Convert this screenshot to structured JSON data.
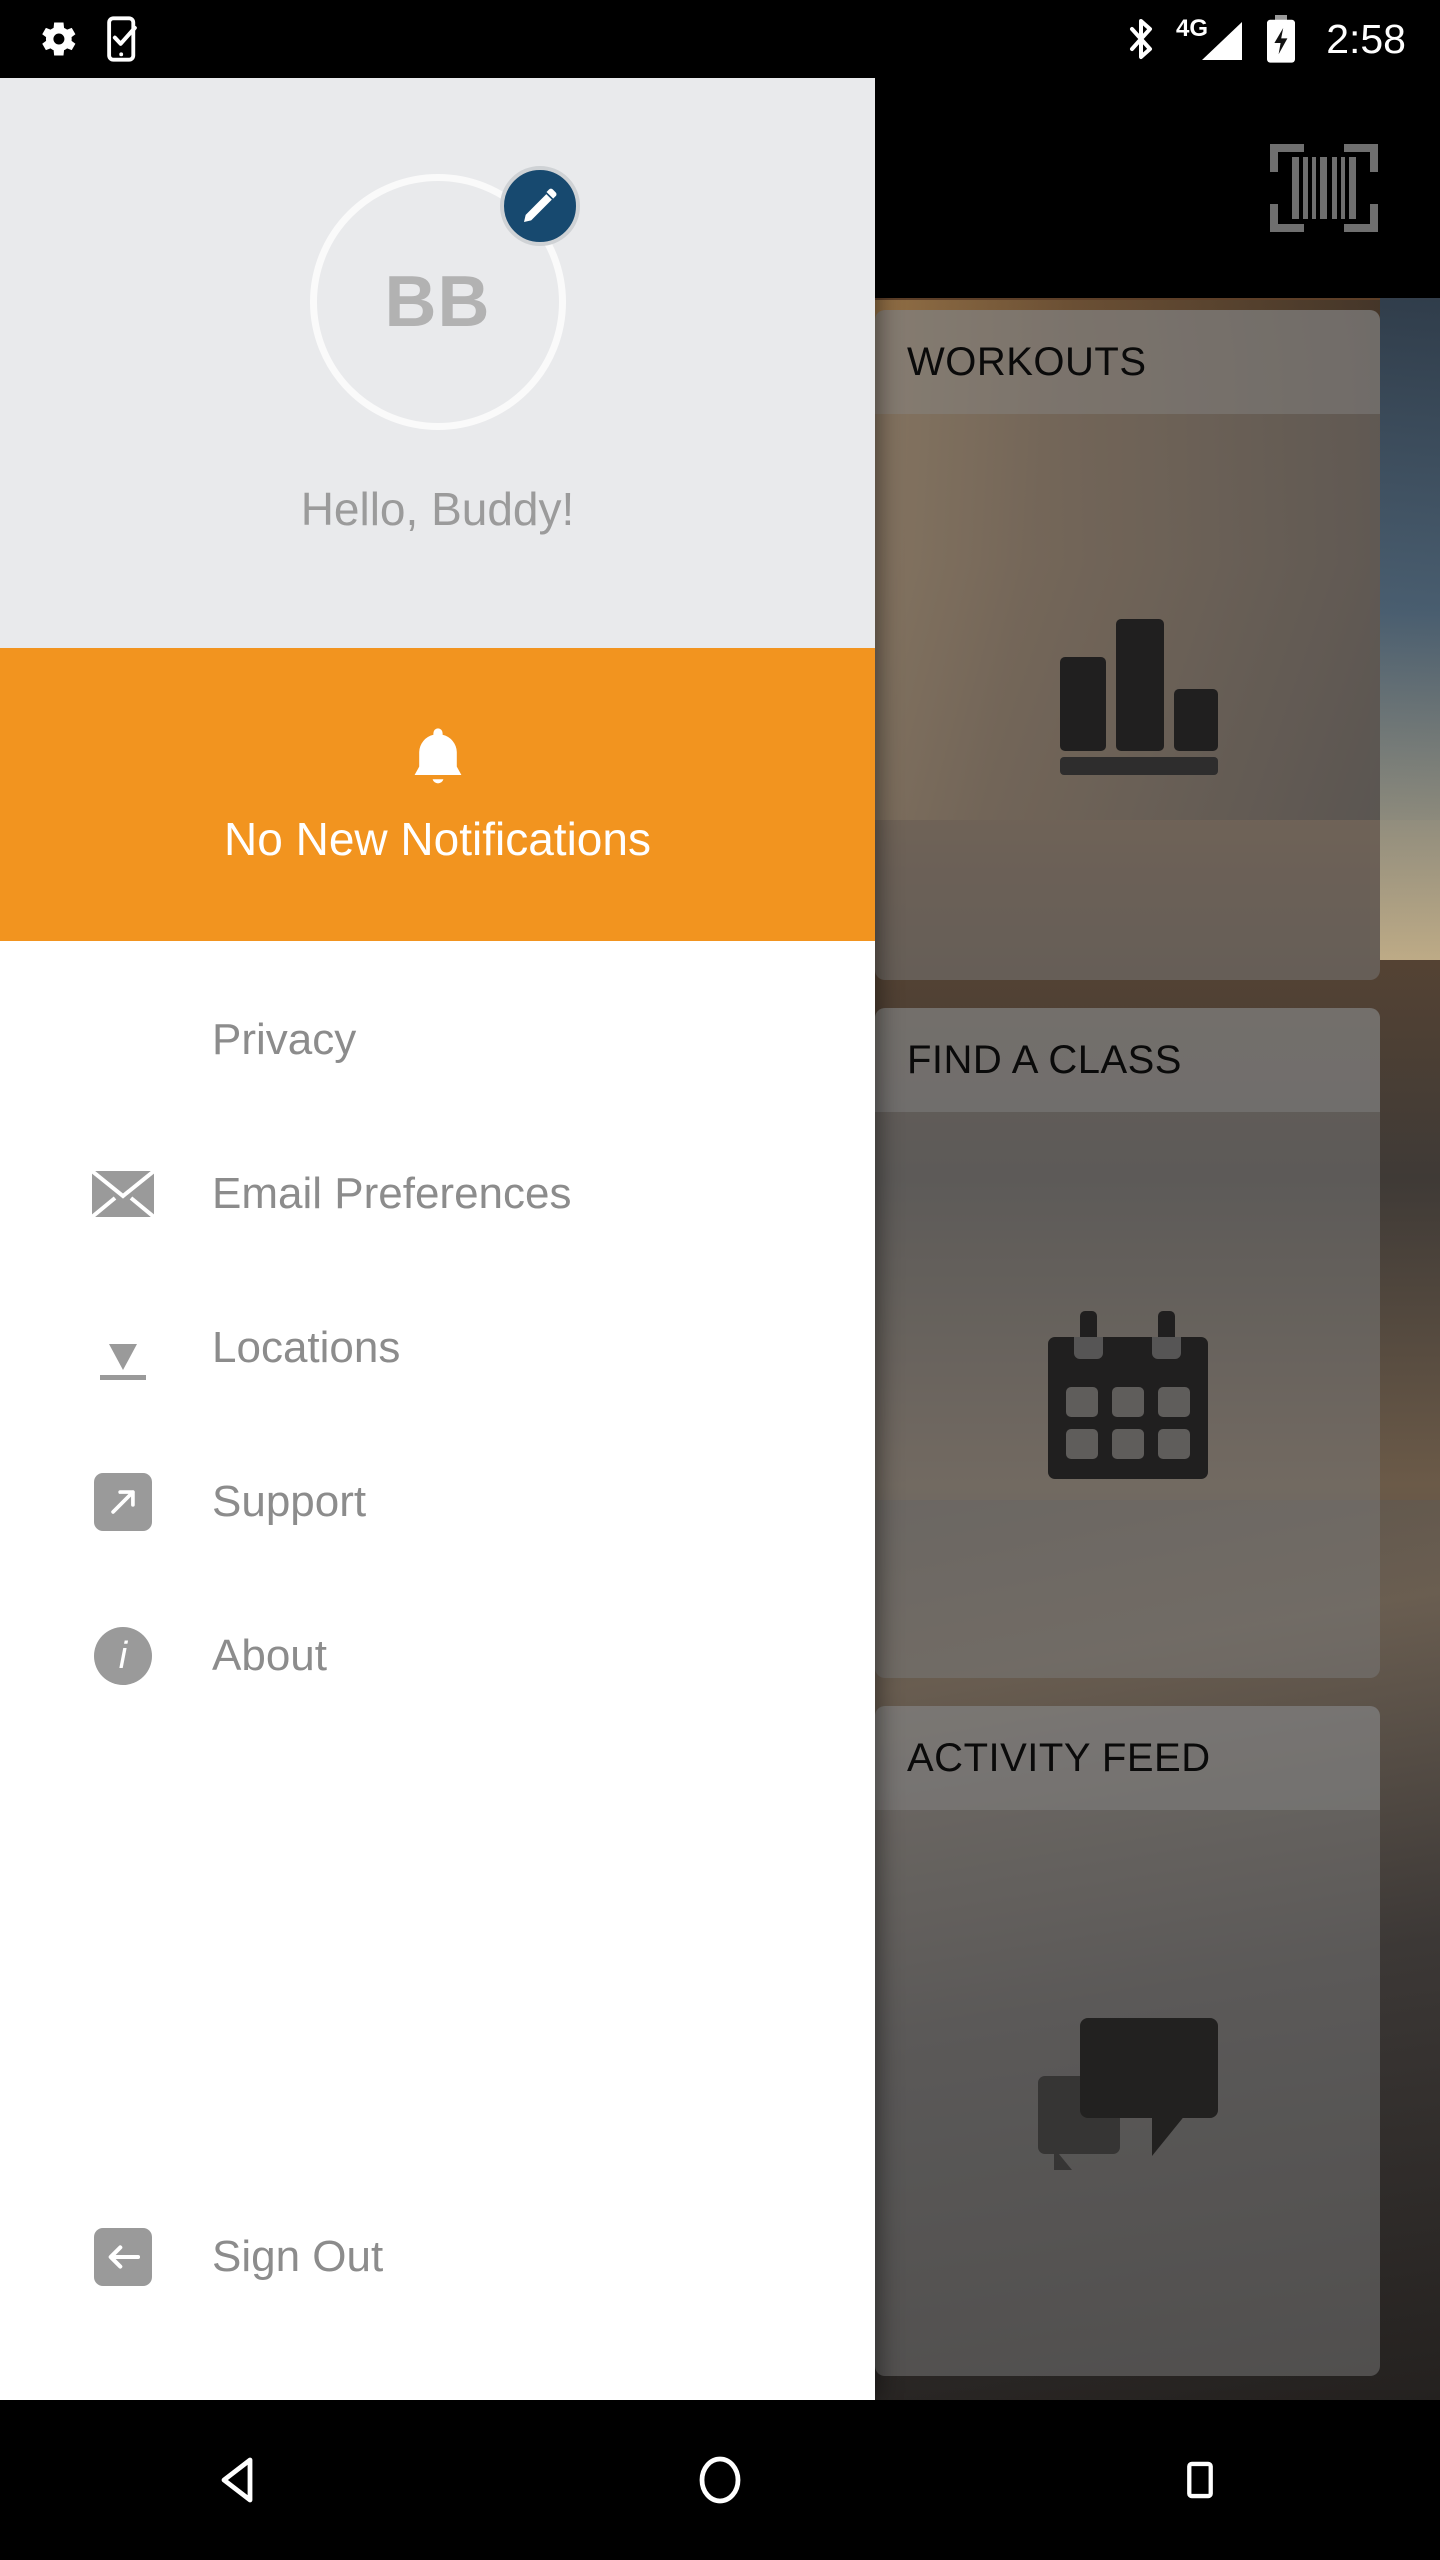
{
  "status_bar": {
    "left_icons": [
      "settings-gear-icon",
      "phone-check-icon"
    ],
    "right_icons": [
      "bluetooth-icon",
      "signal-4g-icon",
      "battery-charging-icon"
    ],
    "network_label": "4G",
    "time": "2:58"
  },
  "background_app": {
    "topbar": {
      "scan_icon": "barcode-scan-icon"
    },
    "cards": [
      {
        "title": "WORKOUTS",
        "icon": "bar-chart-icon"
      },
      {
        "title": "FIND A CLASS",
        "icon": "calendar-icon"
      },
      {
        "title": "ACTIVITY FEED",
        "icon": "chat-bubbles-icon"
      }
    ]
  },
  "drawer": {
    "profile": {
      "initials": "BB",
      "greeting": "Hello, Buddy!",
      "edit_badge_icon": "pencil-edit-icon",
      "edit_badge_color": "#17496F",
      "background_color": "#E9EAEC"
    },
    "notification": {
      "icon": "bell-icon",
      "label": "No New Notifications",
      "background_color": "#F2941F"
    },
    "menu_items": [
      {
        "label": "Privacy",
        "icon": "shield-privacy-icon"
      },
      {
        "label": "Email Preferences",
        "icon": "envelope-icon"
      },
      {
        "label": "Locations",
        "icon": "map-pin-icon"
      },
      {
        "label": "Support",
        "icon": "external-link-icon"
      },
      {
        "label": "About",
        "icon": "info-circle-icon"
      }
    ],
    "sign_out": {
      "label": "Sign Out",
      "icon": "sign-out-arrow-icon"
    }
  },
  "android_navbar": {
    "buttons": [
      {
        "name": "back",
        "icon": "back-triangle-icon"
      },
      {
        "name": "home",
        "icon": "home-circle-icon"
      },
      {
        "name": "recents",
        "icon": "recents-square-icon"
      }
    ]
  }
}
